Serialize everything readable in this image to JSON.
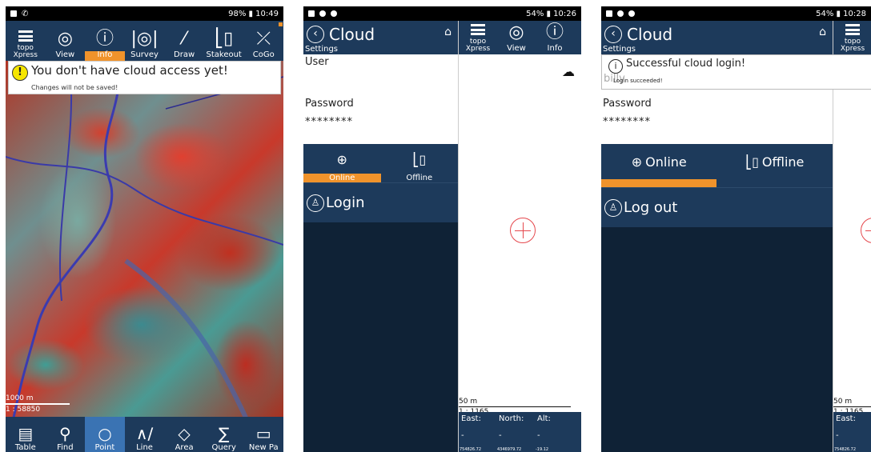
{
  "phone1": {
    "status": {
      "left_icons": [
        "img",
        "phone"
      ],
      "right": "98% ▮ 10:49"
    },
    "toolbar": [
      {
        "icon": "topo-icon",
        "label": "topo\nXpress"
      },
      {
        "icon": "eye-icon",
        "label": "View"
      },
      {
        "icon": "info-icon",
        "label": "Info"
      },
      {
        "icon": "survey-icon",
        "label": "Survey"
      },
      {
        "icon": "draw-icon",
        "label": "Draw"
      },
      {
        "icon": "stakeout-icon",
        "label": "Stakeout"
      },
      {
        "icon": "cogo-icon",
        "label": "CoGo"
      }
    ],
    "active_tool": "Info",
    "warning": {
      "title": "You don't have cloud access yet!",
      "subtitle": "Changes will not be saved!"
    },
    "scale": {
      "distance": "1000 m",
      "ratio": "1 : 58850"
    },
    "bottombar": [
      {
        "icon": "table-icon",
        "label": "Table"
      },
      {
        "icon": "find-icon",
        "label": "Find"
      },
      {
        "icon": "point-icon",
        "label": "Point"
      },
      {
        "icon": "line-icon",
        "label": "Line"
      },
      {
        "icon": "area-icon",
        "label": "Area"
      },
      {
        "icon": "query-icon",
        "label": "Query"
      },
      {
        "icon": "newpage-icon",
        "label": "New Pa"
      }
    ],
    "active_bottom": "Point"
  },
  "phone2": {
    "status": {
      "right": "54% ▮ 10:26"
    },
    "header": {
      "title": "Cloud",
      "settings": "Settings"
    },
    "user_label": "User",
    "password_label": "Password",
    "password_value": "********",
    "tabs": [
      {
        "label": "Online",
        "icon": "globe-icon"
      },
      {
        "label": "Offline",
        "icon": "offline-icon"
      }
    ],
    "active_tab": "Online",
    "action": "Login",
    "map_toolbar": [
      {
        "label": "topo\nXpress"
      },
      {
        "label": "View"
      },
      {
        "label": "Info"
      }
    ],
    "scale": {
      "distance": "50 m",
      "ratio": "1 : 1165"
    },
    "coords": {
      "east_label": "East:",
      "north_label": "North:",
      "alt_label": "Alt:",
      "east": "-",
      "north": "-",
      "alt": "-",
      "east_small": "754826.72",
      "north_small": "4346979.72",
      "alt_small": "-19.12"
    }
  },
  "phone3": {
    "status": {
      "right": "54% ▮ 10:28"
    },
    "header": {
      "title": "Cloud",
      "settings": "Settings"
    },
    "info": {
      "title": "Successful cloud login!",
      "subtitle": "Login succeeded!",
      "ghost": "billy"
    },
    "password_label": "Password",
    "password_value": "********",
    "tabs": [
      {
        "label": "Online"
      },
      {
        "label": "Offline"
      }
    ],
    "action": "Log out",
    "map_toolbar": [
      {
        "label": "topo\nXpress"
      }
    ],
    "scale": {
      "distance": "50 m",
      "ratio": "1 : 1165"
    },
    "coords": {
      "east_label": "East:",
      "east": "-",
      "east_small": "754826.72"
    }
  }
}
